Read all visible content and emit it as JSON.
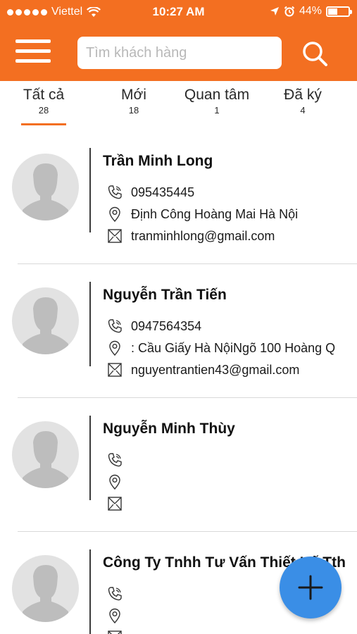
{
  "status_bar": {
    "carrier": "Viettel",
    "time": "10:27 AM",
    "battery": "44%"
  },
  "header": {
    "search_placeholder": "Tìm khách hàng"
  },
  "tabs": [
    {
      "label": "Tất cả",
      "count": "28"
    },
    {
      "label": "Mới",
      "count": "18"
    },
    {
      "label": "Quan tâm",
      "count": "1"
    },
    {
      "label": "Đã ký",
      "count": "4"
    }
  ],
  "contacts": [
    {
      "name": "Trần Minh Long",
      "phone": "095435445",
      "address": "Định Công Hoàng Mai Hà Nội",
      "email": "tranminhlong@gmail.com"
    },
    {
      "name": "Nguyễn Trần Tiến",
      "phone": "0947564354",
      "address": ": Cầu Giấy Hà NộiNgõ 100 Hoàng Q",
      "email": "nguyentrantien43@gmail.com"
    },
    {
      "name": "Nguyễn Minh Thùy",
      "phone": "",
      "address": "",
      "email": ""
    },
    {
      "name": "Công Ty Tnhh Tư Vấn Thiết Kế Tth",
      "phone": "",
      "address": "",
      "email": ""
    }
  ],
  "colors": {
    "brand": "#f36f21",
    "fab": "#3a8ee6"
  }
}
